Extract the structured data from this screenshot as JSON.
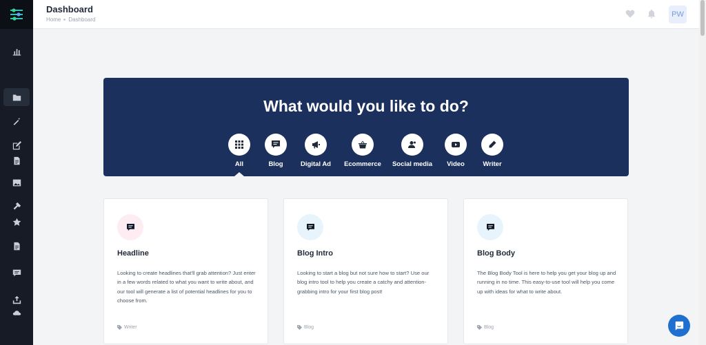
{
  "header": {
    "title": "Dashboard",
    "breadcrumb": [
      "Home",
      "Dashboard"
    ],
    "avatar_initials": "PW"
  },
  "hero": {
    "title": "What would you like to do?",
    "categories": [
      {
        "label": "All",
        "icon": "grid-icon"
      },
      {
        "label": "Blog",
        "icon": "comment-icon"
      },
      {
        "label": "Digital Ad",
        "icon": "megaphone-icon"
      },
      {
        "label": "Ecommerce",
        "icon": "basket-icon"
      },
      {
        "label": "Social media",
        "icon": "users-icon"
      },
      {
        "label": "Video",
        "icon": "youtube-icon"
      },
      {
        "label": "Writer",
        "icon": "pen-icon"
      }
    ],
    "selected": "All"
  },
  "cards": [
    {
      "title": "Headline",
      "description": "Looking to create headlines that'll grab attention? Just enter in a few words related to what you want to write about, and our tool will generate a list of potential headlines for you to choose from.",
      "tag": "Writer",
      "icon_bg": "#fdecf1"
    },
    {
      "title": "Blog Intro",
      "description": "Looking to start a blog but not sure how to start? Use our blog intro tool to help you create a catchy and attention-grabbing intro for your first blog post!",
      "tag": "Blog",
      "icon_bg": "#e8f4fb"
    },
    {
      "title": "Blog Body",
      "description": "The Blog Body Tool is here to help you get your blog up and running in no time. This easy-to-use tool will help you come up with ideas for what to write about.",
      "tag": "Blog",
      "icon_bg": "#e8f4fb"
    }
  ],
  "colors": {
    "sidebar": "#161b26",
    "hero": "#1c305e",
    "accent": "#1f6fd0"
  }
}
